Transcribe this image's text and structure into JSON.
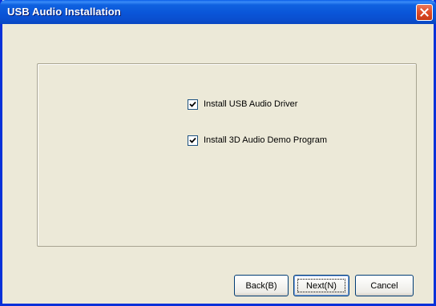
{
  "window": {
    "title": "USB Audio Installation"
  },
  "options": [
    {
      "label": "Install USB Audio Driver",
      "checked": true
    },
    {
      "label": "Install 3D Audio Demo Program",
      "checked": true
    }
  ],
  "buttons": {
    "back_label": "Back(B)",
    "next_label": "Next(N)",
    "cancel_label": "Cancel"
  },
  "icons": {
    "close": "close-icon",
    "checkmark": "checkmark-icon"
  },
  "colors": {
    "titlebar": "#0a55d8",
    "close_button": "#e04e2a",
    "dialog_background": "#ece9d8",
    "button_border": "#003c74"
  }
}
